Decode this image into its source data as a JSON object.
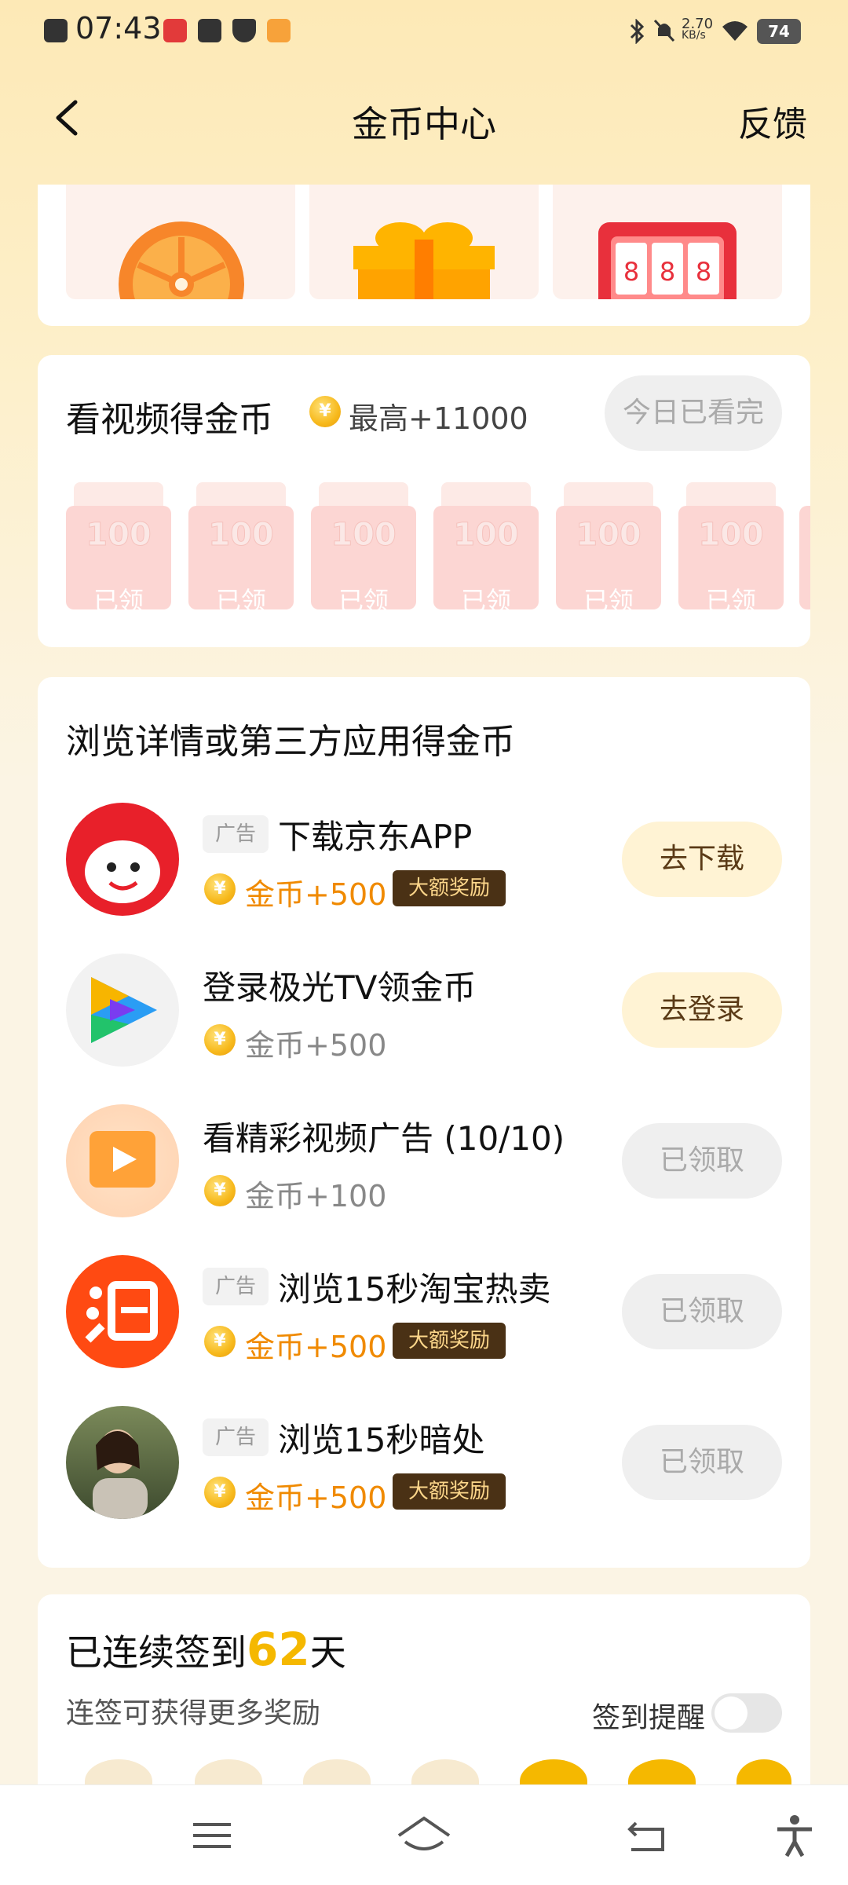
{
  "status_bar": {
    "time": "07:43",
    "net_speed": "2.70",
    "net_unit": "KB/s",
    "battery": "74"
  },
  "header": {
    "title": "金币中心",
    "feedback": "反馈"
  },
  "video_section": {
    "title": "看视频得金币",
    "max_reward": "最高+11000",
    "status_button": "今日已看完",
    "envelopes": [
      {
        "amount": "100",
        "status": "已领"
      },
      {
        "amount": "100",
        "status": "已领"
      },
      {
        "amount": "100",
        "status": "已领"
      },
      {
        "amount": "100",
        "status": "已领"
      },
      {
        "amount": "100",
        "status": "已领"
      },
      {
        "amount": "100",
        "status": "已领"
      }
    ]
  },
  "browse_section": {
    "title": "浏览详情或第三方应用得金币",
    "tasks": [
      {
        "ad_tag": "广告",
        "title": "下载京东APP",
        "reward": "金币+500",
        "badge": "大额奖励",
        "button": "去下载"
      },
      {
        "title": "登录极光TV领金币",
        "reward": "金币+500",
        "button": "去登录"
      },
      {
        "title": "看精彩视频广告 (10/10)",
        "reward": "金币+100",
        "button": "已领取"
      },
      {
        "ad_tag": "广告",
        "title": "浏览15秒淘宝热卖",
        "reward": "金币+500",
        "badge": "大额奖励",
        "button": "已领取"
      },
      {
        "ad_tag": "广告",
        "title": "浏览15秒暗处",
        "reward": "金币+500",
        "badge": "大额奖励",
        "button": "已领取"
      }
    ]
  },
  "sign_section": {
    "prefix": "已连续签到",
    "days": "62",
    "suffix": "天",
    "subtitle": "连签可获得更多奖励",
    "remind_label": "签到提醒",
    "remind_on": false
  },
  "colors": {
    "accent_orange": "#f08a00",
    "sign_days": "#f5b800",
    "badge_bg": "#4a3115"
  },
  "icons": {
    "coin": "¥",
    "slot": "8"
  }
}
